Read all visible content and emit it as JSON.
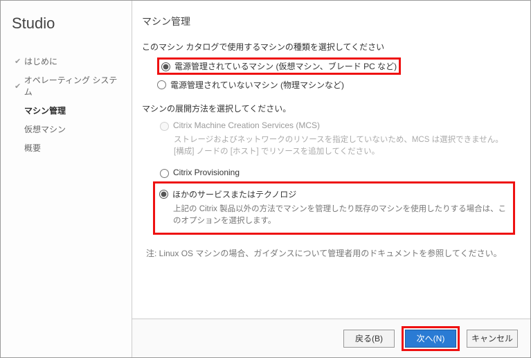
{
  "app_title": "Studio",
  "nav": {
    "items": [
      {
        "label": "はじめに",
        "done": true,
        "current": false
      },
      {
        "label": "オペレーティング システム",
        "done": true,
        "current": false
      },
      {
        "label": "マシン管理",
        "done": false,
        "current": true
      },
      {
        "label": "仮想マシン",
        "done": false,
        "current": false
      },
      {
        "label": "概要",
        "done": false,
        "current": false
      }
    ]
  },
  "page": {
    "title": "マシン管理",
    "type_prompt": "このマシン カタログで使用するマシンの種類を選択してください",
    "type_options": [
      {
        "label": "電源管理されているマシン (仮想マシン、ブレード PC など)",
        "selected": true,
        "highlighted": true
      },
      {
        "label": "電源管理されていないマシン (物理マシンなど)",
        "selected": false,
        "highlighted": false
      }
    ],
    "deploy_prompt": "マシンの展開方法を選択してください。",
    "deploy_options": [
      {
        "label": "Citrix Machine Creation Services (MCS)",
        "selected": false,
        "disabled": true,
        "highlighted": false,
        "desc": "ストレージおよびネットワークのリソースを指定していないため、MCS は選択できません。[構成] ノードの [ホスト] でリソースを追加してください。"
      },
      {
        "label": "Citrix Provisioning",
        "selected": false,
        "disabled": false,
        "highlighted": false,
        "desc": ""
      },
      {
        "label": "ほかのサービスまたはテクノロジ",
        "selected": true,
        "disabled": false,
        "highlighted": true,
        "desc": "上記の Citrix 製品以外の方法でマシンを管理したり既存のマシンを使用したりする場合は、このオプションを選択します。"
      }
    ],
    "note": "注: Linux OS マシンの場合、ガイダンスについて管理者用のドキュメントを参照してください。"
  },
  "footer": {
    "back": "戻る(B)",
    "next": "次へ(N)",
    "cancel": "キャンセル"
  }
}
